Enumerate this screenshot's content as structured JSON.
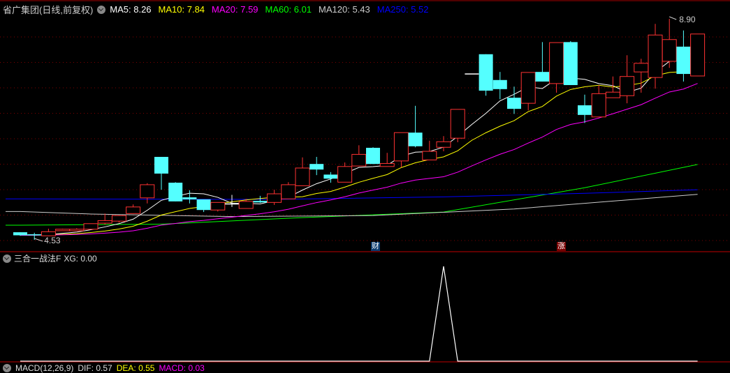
{
  "header": {
    "title": "省广集团(日线,前复权)",
    "ma": [
      {
        "label": "MA5: 8.26",
        "color": "#ffffff"
      },
      {
        "label": "MA10: 7.84",
        "color": "#ffff00"
      },
      {
        "label": "MA20: 7.59",
        "color": "#ff00ff"
      },
      {
        "label": "MA60: 6.01",
        "color": "#00ff00"
      },
      {
        "label": "MA120: 5.43",
        "color": "#cccccc"
      },
      {
        "label": "MA250: 5.52",
        "color": "#0000ff"
      }
    ]
  },
  "indicator": {
    "title": "三合一战法F",
    "xg_label": "XG: 0.00"
  },
  "macd": {
    "title": "MACD(12,26,9)",
    "dif": "DIF: 0.57",
    "dea": "DEA: 0.55",
    "macd": "MACD: 0.03"
  },
  "badges": {
    "cai": "财",
    "zhang": "涨"
  },
  "chart_data": {
    "type": "candlestick",
    "price_range": [
      4.53,
      8.9
    ],
    "high_label": "8.90",
    "low_label": "4.53",
    "colors": {
      "up": "#ff3232",
      "down": "#54ffff",
      "grid": "#800000"
    },
    "ohlc": [
      [
        4.68,
        4.62,
        4.68,
        4.61
      ],
      [
        4.64,
        4.63,
        4.67,
        4.53
      ],
      [
        4.61,
        4.69,
        4.75,
        4.61
      ],
      [
        4.71,
        4.74,
        4.75,
        4.71
      ],
      [
        4.71,
        4.74,
        4.76,
        4.71
      ],
      [
        4.74,
        4.85,
        4.85,
        4.74
      ],
      [
        4.86,
        4.91,
        5.05,
        4.83
      ],
      [
        4.9,
        5.01,
        5.01,
        4.87
      ],
      [
        5.05,
        5.18,
        5.23,
        5.05
      ],
      [
        5.36,
        5.62,
        5.65,
        5.25
      ],
      [
        6.17,
        5.84,
        6.17,
        5.52
      ],
      [
        5.66,
        5.29,
        5.67,
        5.29
      ],
      [
        5.37,
        5.33,
        5.51,
        5.25
      ],
      [
        5.33,
        5.12,
        5.33,
        5.08
      ],
      [
        5.12,
        5.27,
        5.27,
        5.09
      ],
      [
        5.25,
        5.25,
        5.42,
        5.18
      ],
      [
        5.15,
        5.29,
        5.34,
        5.15
      ],
      [
        5.3,
        5.27,
        5.4,
        5.26
      ],
      [
        5.27,
        5.44,
        5.52,
        5.22
      ],
      [
        5.34,
        5.62,
        5.67,
        5.34
      ],
      [
        5.6,
        5.95,
        6.16,
        5.6
      ],
      [
        6.03,
        5.92,
        6.17,
        5.81
      ],
      [
        5.82,
        5.74,
        5.87,
        5.66
      ],
      [
        5.67,
        5.98,
        6.06,
        5.67
      ],
      [
        5.99,
        6.22,
        6.4,
        5.99
      ],
      [
        6.35,
        6.03,
        6.36,
        6.03
      ],
      [
        5.98,
        6.04,
        6.25,
        5.98
      ],
      [
        6.09,
        6.65,
        6.65,
        5.96
      ],
      [
        6.65,
        6.38,
        7.18,
        6.36
      ],
      [
        6.11,
        6.28,
        6.49,
        6.11
      ],
      [
        6.36,
        6.47,
        6.58,
        6.28
      ],
      [
        6.54,
        7.11,
        7.11,
        6.46
      ],
      [
        7.82,
        7.82,
        7.82,
        7.82
      ],
      [
        8.2,
        7.48,
        8.2,
        7.38
      ],
      [
        7.69,
        7.51,
        7.85,
        7.31
      ],
      [
        7.34,
        7.12,
        7.56,
        7.02
      ],
      [
        7.23,
        7.84,
        7.84,
        7.09
      ],
      [
        7.85,
        7.66,
        8.44,
        7.66
      ],
      [
        7.62,
        8.43,
        8.43,
        7.44
      ],
      [
        8.44,
        7.59,
        8.46,
        7.59
      ],
      [
        7.19,
        7.0,
        7.4,
        6.84
      ],
      [
        6.96,
        7.42,
        7.59,
        6.96
      ],
      [
        7.34,
        7.45,
        7.76,
        7.34
      ],
      [
        7.38,
        7.76,
        8.18,
        7.23
      ],
      [
        7.85,
        8.02,
        8.11,
        7.44
      ],
      [
        7.74,
        8.58,
        8.8,
        7.52
      ],
      [
        8.06,
        8.49,
        8.9,
        7.93
      ],
      [
        8.35,
        7.81,
        8.67,
        7.66
      ],
      [
        7.77,
        8.6,
        8.6,
        7.77
      ]
    ],
    "ma_long": {
      "MA60": [
        [
          0,
          4.82
        ],
        [
          10,
          4.84
        ],
        [
          20,
          4.97
        ],
        [
          30,
          5.08
        ],
        [
          40,
          5.56
        ],
        [
          48,
          6.02
        ]
      ],
      "MA120": [
        [
          0,
          5.09
        ],
        [
          5,
          5.04
        ],
        [
          15,
          4.99
        ],
        [
          25,
          5.01
        ],
        [
          35,
          5.14
        ],
        [
          48,
          5.43
        ]
      ],
      "MA250": [
        [
          0,
          5.34
        ],
        [
          18,
          5.33
        ],
        [
          30,
          5.38
        ],
        [
          40,
          5.45
        ],
        [
          48,
          5.52
        ]
      ]
    },
    "xg": {
      "values_nonzero": [
        [
          30,
          1
        ]
      ],
      "range": [
        0,
        1
      ]
    }
  }
}
